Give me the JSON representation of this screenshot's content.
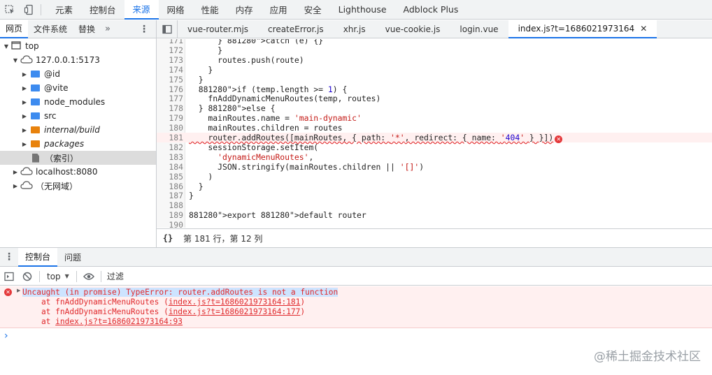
{
  "toolbar": {
    "tabs": [
      {
        "label": "元素",
        "active": false
      },
      {
        "label": "控制台",
        "active": false
      },
      {
        "label": "来源",
        "active": true
      },
      {
        "label": "网络",
        "active": false
      },
      {
        "label": "性能",
        "active": false
      },
      {
        "label": "内存",
        "active": false
      },
      {
        "label": "应用",
        "active": false
      },
      {
        "label": "安全",
        "active": false
      },
      {
        "label": "Lighthouse",
        "active": false
      },
      {
        "label": "Adblock Plus",
        "active": false
      }
    ]
  },
  "navigator": {
    "tabs": [
      {
        "label": "网页",
        "active": true
      },
      {
        "label": "文件系统",
        "active": false
      },
      {
        "label": "替换",
        "active": false
      }
    ],
    "more": "»",
    "tree": [
      {
        "label": "top",
        "icon": "frame-icon",
        "expanded": true
      },
      {
        "label": "127.0.0.1:5173",
        "icon": "cloud-icon",
        "expanded": true
      },
      {
        "label": "@id",
        "icon": "folder-icon",
        "color": "#3d8bef",
        "expanded": false
      },
      {
        "label": "@vite",
        "icon": "folder-icon",
        "color": "#3d8bef",
        "expanded": false
      },
      {
        "label": "node_modules",
        "icon": "folder-icon",
        "color": "#3d8bef",
        "expanded": false
      },
      {
        "label": "src",
        "icon": "folder-icon",
        "color": "#3d8bef",
        "expanded": false
      },
      {
        "label": "internal/build",
        "icon": "folder-icon",
        "color": "#e8820c",
        "expanded": false
      },
      {
        "label": "packages",
        "icon": "folder-icon",
        "color": "#e8820c",
        "expanded": false
      },
      {
        "label": "（索引）",
        "icon": "file-icon",
        "selected": true
      },
      {
        "label": "localhost:8080",
        "icon": "cloud-icon",
        "expanded": false
      },
      {
        "label": "（无网域）",
        "icon": "cloud-icon",
        "expanded": false
      }
    ]
  },
  "editor": {
    "tabs": [
      {
        "label": "vue-router.mjs",
        "active": false
      },
      {
        "label": "createError.js",
        "active": false
      },
      {
        "label": "xhr.js",
        "active": false
      },
      {
        "label": "vue-cookie.js",
        "active": false
      },
      {
        "label": "login.vue",
        "active": false
      },
      {
        "label": "index.js?t=1686021973164",
        "active": true,
        "closable": true
      }
    ],
    "close_glyph": "✕",
    "lines": [
      {
        "n": "171",
        "code": "      } catch (e) {}"
      },
      {
        "n": "172",
        "code": "      }"
      },
      {
        "n": "173",
        "code": "      routes.push(route)"
      },
      {
        "n": "174",
        "code": "    }"
      },
      {
        "n": "175",
        "code": "  }"
      },
      {
        "n": "176",
        "code": "  if (temp.length >= 1) {"
      },
      {
        "n": "177",
        "code": "    fnAddDynamicMenuRoutes(temp, routes)"
      },
      {
        "n": "178",
        "code": "  } else {"
      },
      {
        "n": "179",
        "code": "    mainRoutes.name = 'main-dynamic'"
      },
      {
        "n": "180",
        "code": "    mainRoutes.children = routes"
      },
      {
        "n": "181",
        "code": "    router.addRoutes([mainRoutes, { path: '*', redirect: { name: '404' } }])",
        "error": true
      },
      {
        "n": "182",
        "code": "    sessionStorage.setItem("
      },
      {
        "n": "183",
        "code": "      'dynamicMenuRoutes',"
      },
      {
        "n": "184",
        "code": "      JSON.stringify(mainRoutes.children || '[]')"
      },
      {
        "n": "185",
        "code": "    )"
      },
      {
        "n": "186",
        "code": "  }"
      },
      {
        "n": "187",
        "code": "}"
      },
      {
        "n": "188",
        "code": ""
      },
      {
        "n": "189",
        "code": "export default router"
      },
      {
        "n": "190",
        "code": ""
      }
    ],
    "status": "第 181 行，第 12 列",
    "braces": "{}"
  },
  "drawer": {
    "tabs": [
      {
        "label": "控制台",
        "active": true
      },
      {
        "label": "问题",
        "active": false
      }
    ],
    "context": "top",
    "filter_placeholder": "过滤"
  },
  "console": {
    "error_message": "Uncaught (in promise) TypeError: router.addRoutes is not a function",
    "stack": [
      {
        "prefix": "    at fnAddDynamicMenuRoutes (",
        "link": "index.js?t=1686021973164:181",
        "suffix": ")"
      },
      {
        "prefix": "    at fnAddDynamicMenuRoutes (",
        "link": "index.js?t=1686021973164:177",
        "suffix": ")"
      },
      {
        "prefix": "    at ",
        "link": "index.js?t=1686021973164:93",
        "suffix": ""
      }
    ],
    "prompt": "›"
  },
  "watermark": "@稀土掘金技术社区",
  "colors": {
    "accent": "#1a73e8",
    "error": "#e0292c",
    "error_bg": "#fff0f0"
  }
}
